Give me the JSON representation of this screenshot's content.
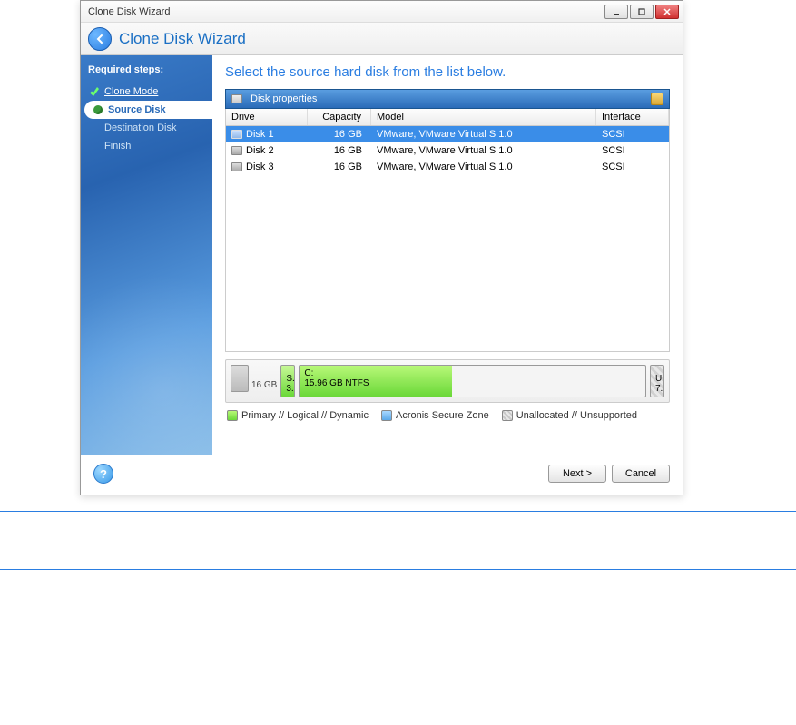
{
  "window": {
    "title": "Clone Disk Wizard"
  },
  "header": {
    "title": "Clone Disk Wizard"
  },
  "sidebar": {
    "required_label": "Required steps:",
    "steps": [
      {
        "label": "Clone Mode",
        "state": "done"
      },
      {
        "label": "Source Disk",
        "state": "current"
      },
      {
        "label": "Destination Disk",
        "state": "pending_link"
      },
      {
        "label": "Finish",
        "state": "pending"
      }
    ]
  },
  "main": {
    "instruction": "Select the source hard disk from the list below.",
    "props_title": "Disk properties",
    "columns": {
      "drive": "Drive",
      "capacity": "Capacity",
      "model": "Model",
      "interface": "Interface"
    },
    "disks": [
      {
        "drive": "Disk 1",
        "capacity": "16 GB",
        "model": "VMware, VMware Virtual S 1.0",
        "interface": "SCSI",
        "selected": true
      },
      {
        "drive": "Disk 2",
        "capacity": "16 GB",
        "model": "VMware, VMware Virtual S 1.0",
        "interface": "SCSI",
        "selected": false
      },
      {
        "drive": "Disk 3",
        "capacity": "16 GB",
        "model": "VMware, VMware Virtual S 1.0",
        "interface": "SCSI",
        "selected": false
      }
    ],
    "partition_map": {
      "total": "16 GB",
      "sys_label": "S...",
      "sys_size": "3...",
      "main_label": "C:",
      "main_size": "15.96 GB  NTFS",
      "un_label": "U...",
      "un_size": "7..."
    },
    "legend": {
      "primary": "Primary // Logical // Dynamic",
      "secure": "Acronis Secure Zone",
      "unalloc": "Unallocated // Unsupported"
    }
  },
  "buttons": {
    "next": "Next >",
    "cancel": "Cancel"
  },
  "colors": {
    "accent": "#2a7de1",
    "selected_row": "#3a8de8",
    "partition_green": "#6ad838"
  }
}
